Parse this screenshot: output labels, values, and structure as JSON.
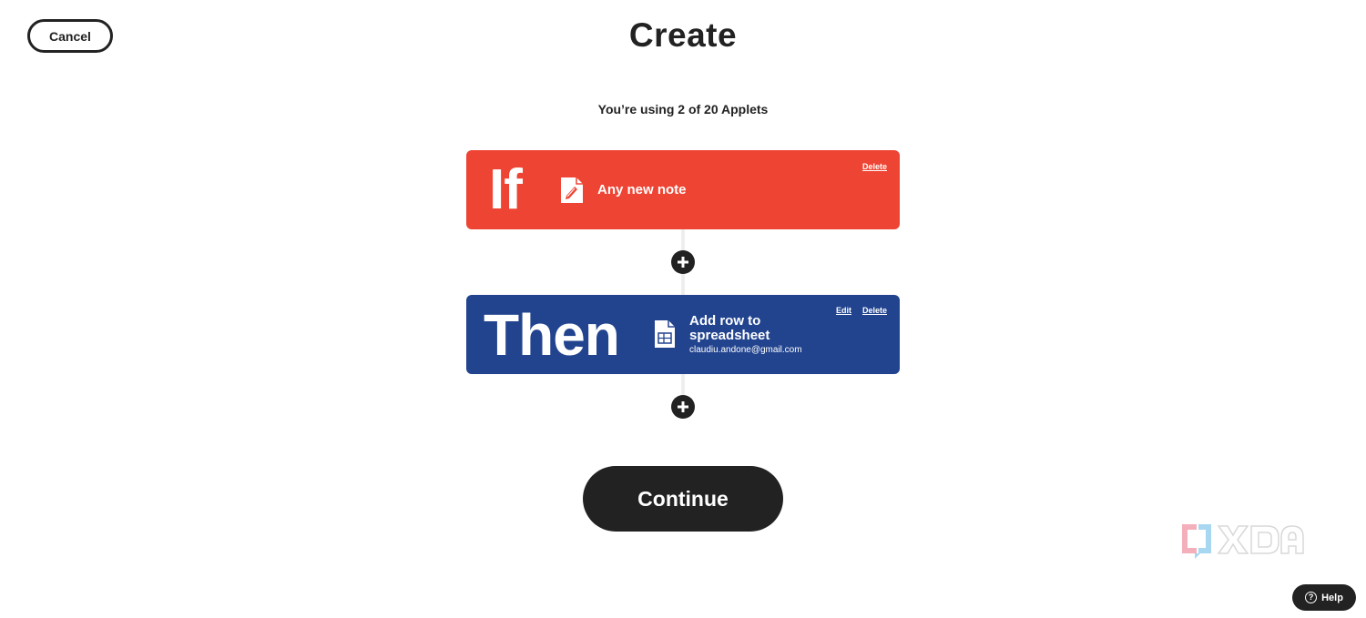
{
  "header": {
    "cancel_label": "Cancel",
    "title": "Create"
  },
  "usage": {
    "text": "You’re using 2 of 20 Applets"
  },
  "if_card": {
    "keyword": "If",
    "icon": "note-pencil-icon",
    "title": "Any new note",
    "delete_label": "Delete",
    "color": "#ee4433"
  },
  "then_card": {
    "keyword": "Then",
    "icon": "spreadsheet-icon",
    "title": "Add row to spreadsheet",
    "account": "claudiu.andone@gmail.com",
    "edit_label": "Edit",
    "delete_label": "Delete",
    "color": "#22448f"
  },
  "actions": {
    "continue_label": "Continue",
    "help_label": "Help"
  },
  "watermark": {
    "text": "XDA"
  }
}
